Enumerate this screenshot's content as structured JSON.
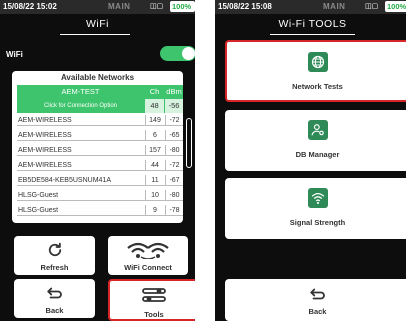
{
  "colors": {
    "accent": "#3ec46d",
    "selected_outline": "#d7262a",
    "icon_tile": "#2e8a57",
    "background": "#0d0d0d"
  },
  "left_screen": {
    "status": {
      "time": "15/08/22 15:02",
      "mode": "MAIN",
      "icons": "rss-icon",
      "battery": "100%"
    },
    "title": "WiFi",
    "wifi_label": "WiFi",
    "wifi_enabled": true,
    "networks": {
      "title": "Available Networks",
      "header": {
        "name": "AEM-TEST",
        "ch": "Ch",
        "dbm": "dBm"
      },
      "subheader": {
        "hint": "Click for Connection Option",
        "ch": "48",
        "dbm": "-56"
      },
      "rows": [
        {
          "name": "AEM-WIRELESS",
          "ch": "149",
          "dbm": "-72"
        },
        {
          "name": "AEM-WIRELESS",
          "ch": "6",
          "dbm": "-65"
        },
        {
          "name": "AEM-WIRELESS",
          "ch": "157",
          "dbm": "-80"
        },
        {
          "name": "AEM-WIRELESS",
          "ch": "44",
          "dbm": "-72"
        },
        {
          "name": "EB5DE584-KEB5USNUM41A",
          "ch": "11",
          "dbm": "-67"
        },
        {
          "name": "HLSG-Guest",
          "ch": "10",
          "dbm": "-80"
        },
        {
          "name": "HLSG-Guest",
          "ch": "9",
          "dbm": "-78"
        }
      ]
    },
    "buttons": {
      "refresh": "Refresh",
      "wifi_connect": "WiFi Connect",
      "back": "Back",
      "tools": "Tools"
    }
  },
  "right_screen": {
    "status": {
      "time": "15/08/22 15:08",
      "mode": "MAIN",
      "icons": "rss-icon",
      "battery": "100%"
    },
    "title": "Wi-Fi TOOLS",
    "cards": {
      "network_tests": "Network Tests",
      "db_manager": "DB Manager",
      "signal_strength": "Signal Strength"
    },
    "back": "Back"
  }
}
